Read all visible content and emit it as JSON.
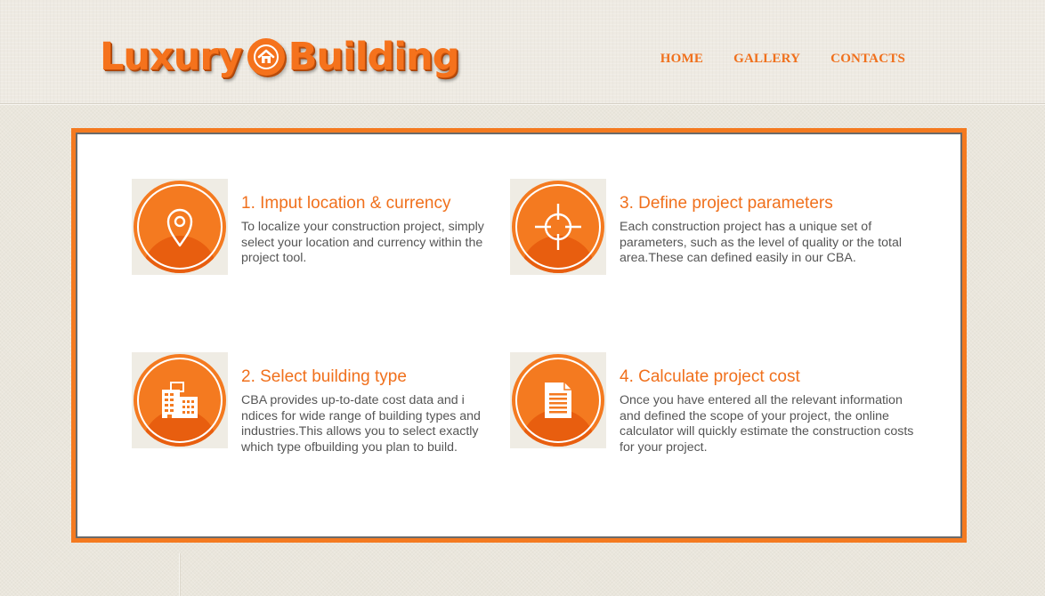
{
  "logo": {
    "word1": "Luxury",
    "word2": "Building"
  },
  "nav": {
    "home": "HOME",
    "gallery": "GALLERY",
    "contacts": "CONTACTS"
  },
  "steps": [
    {
      "title": "1. Imput location & currency",
      "text": "To localize your construction project, simply select your location and currency within the project tool.",
      "icon": "location-pin-icon"
    },
    {
      "title": "3. Define project parameters",
      "text": "Each construction project has a unique set of parameters, such as the level of quality or the total area.These can defined easily in our CBA.",
      "icon": "crosshair-icon"
    },
    {
      "title": "2. Select building type",
      "text": "CBA provides up-to-date cost data and i ndices for wide range of building types and industries.This allows you to select exactly which type ofbuilding you plan to build.",
      "icon": "buildings-icon"
    },
    {
      "title": "4. Calculate project cost",
      "text": "Once you have entered all the relevant information and defined the scope of your project, the online calculator will quickly estimate the construction costs for your project.",
      "icon": "document-icon"
    }
  ],
  "colors": {
    "accent": "#f47a20",
    "accent_dark": "#e85e0f",
    "body_text": "#555555",
    "background": "#eae6dc"
  }
}
